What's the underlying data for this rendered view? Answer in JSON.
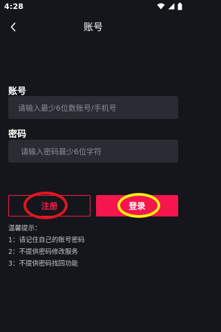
{
  "status_bar": {
    "time": "4:28"
  },
  "header": {
    "title": "账号"
  },
  "account": {
    "label": "账号",
    "placeholder": "请输入最少6位数账号/手机号"
  },
  "password": {
    "label": "密码",
    "placeholder": "请输入密码最少6位字符"
  },
  "buttons": {
    "register": "注册",
    "login": "登录"
  },
  "tips": {
    "title": "温馨提示：",
    "items": [
      "1：请记住自己的账号密码",
      "2：不提供密码修改服务",
      "3：不提供密码找回功能"
    ]
  },
  "colors": {
    "accent": "#f5164e",
    "background": "#15161b",
    "input_bg": "#2b2c33",
    "annotation_red": "#e0161e",
    "annotation_yellow": "#f4f00e"
  }
}
